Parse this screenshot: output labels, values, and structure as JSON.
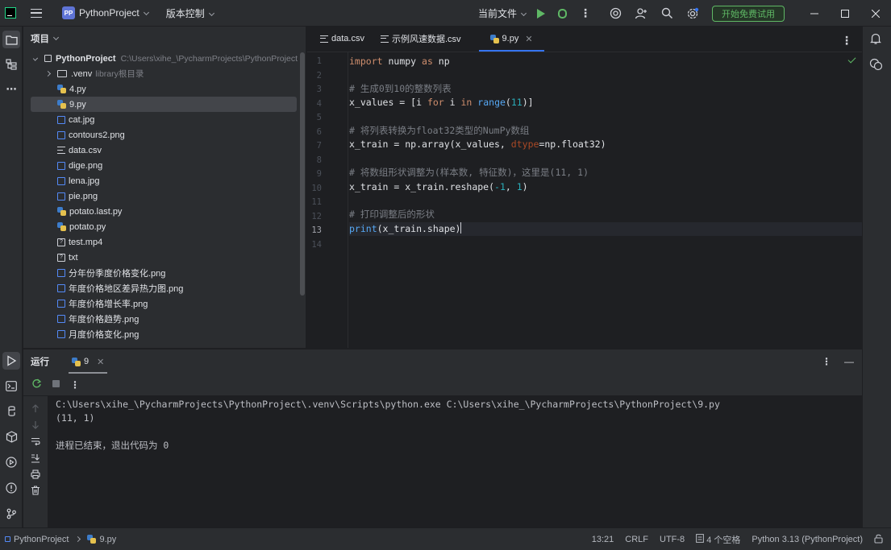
{
  "titlebar": {
    "project_badge": "PP",
    "project_name": "PythonProject",
    "vcs_label": "版本控制",
    "run_config": "当前文件",
    "trial_button": "开始免费试用"
  },
  "project_panel": {
    "title": "项目",
    "root_name": "PythonProject",
    "root_path": "C:\\Users\\xihe_\\PycharmProjects\\PythonProject",
    "venv_name": ".venv",
    "venv_hint": "library根目录",
    "files": [
      {
        "name": "4.py",
        "type": "py"
      },
      {
        "name": "9.py",
        "type": "py",
        "selected": true
      },
      {
        "name": "cat.jpg",
        "type": "img"
      },
      {
        "name": "contours2.png",
        "type": "img"
      },
      {
        "name": "data.csv",
        "type": "csv"
      },
      {
        "name": "dige.png",
        "type": "img"
      },
      {
        "name": "lena.jpg",
        "type": "img"
      },
      {
        "name": "pie.png",
        "type": "img"
      },
      {
        "name": "potato.last.py",
        "type": "py"
      },
      {
        "name": "potato.py",
        "type": "py"
      },
      {
        "name": "test.mp4",
        "type": "unk"
      },
      {
        "name": "txt",
        "type": "unk"
      },
      {
        "name": "分年份季度价格变化.png",
        "type": "img"
      },
      {
        "name": "年度价格地区差异热力图.png",
        "type": "img"
      },
      {
        "name": "年度价格增长率.png",
        "type": "img"
      },
      {
        "name": "年度价格趋势.png",
        "type": "img"
      },
      {
        "name": "月度价格变化.png",
        "type": "img"
      }
    ]
  },
  "editor": {
    "tabs": [
      {
        "label": "data.csv",
        "type": "csv"
      },
      {
        "label": "示例风速数据.csv",
        "type": "csv"
      },
      {
        "label": "9.py",
        "type": "py",
        "active": true
      }
    ],
    "line_numbers": [
      "1",
      "2",
      "3",
      "4",
      "5",
      "6",
      "7",
      "8",
      "9",
      "10",
      "11",
      "12",
      "13",
      "14"
    ],
    "current_line": 13,
    "code": {
      "l1_kw": "import",
      "l1_mod": " numpy ",
      "l1_as": "as",
      "l1_alias": " np",
      "l3": "# 生成0到10的整数列表",
      "l4_a": "x_values = [i ",
      "l4_for": "for",
      "l4_b": " i ",
      "l4_in": "in",
      "l4_c": " ",
      "l4_fn": "range",
      "l4_d": "(",
      "l4_num": "11",
      "l4_e": ")]",
      "l6": "# 将列表转换为float32类型的NumPy数组",
      "l7_a": "x_train = np.array(x_values, ",
      "l7_prm": "dtype",
      "l7_b": "=np.float32)",
      "l9": "# 将数组形状调整为(样本数, 特征数)，这里是(11, 1)",
      "l10_a": "x_train = x_train.reshape(",
      "l10_n1": "-1",
      "l10_b": ", ",
      "l10_n2": "1",
      "l10_c": ")",
      "l12": "# 打印调整后的形状",
      "l13_fn": "print",
      "l13_a": "(x_train.shape)"
    }
  },
  "run_panel": {
    "title": "运行",
    "tab_label": "9",
    "output": [
      "C:\\Users\\xihe_\\PycharmProjects\\PythonProject\\.venv\\Scripts\\python.exe C:\\Users\\xihe_\\PycharmProjects\\PythonProject\\9.py",
      "(11, 1)",
      "",
      "进程已结束，退出代码为 0"
    ]
  },
  "statusbar": {
    "breadcrumb_project": "PythonProject",
    "breadcrumb_file": "9.py",
    "position": "13:21",
    "line_sep": "CRLF",
    "encoding": "UTF-8",
    "indent": "4 个空格",
    "interpreter": "Python 3.13 (PythonProject)"
  },
  "colors": {
    "accent": "#3574f0",
    "run_green": "#5fb865",
    "background": "#1e1f22",
    "panel": "#2b2d30"
  }
}
